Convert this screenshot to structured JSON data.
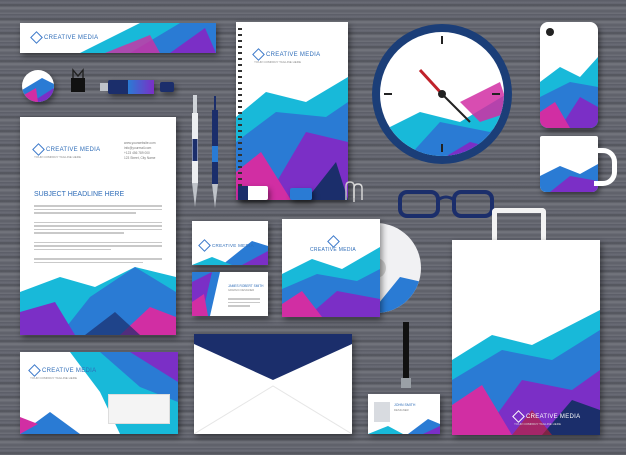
{
  "brand": {
    "name": "CREATIVE MEDIA",
    "tagline": "YOUR COMPANY TAGLINE HERE"
  },
  "letterhead": {
    "headline": "SUBJECT HEADLINE HERE",
    "contact": [
      "www.yourwebsite.com",
      "info@yourmail.com",
      "+123 456 789 000",
      "123 Street, City Name"
    ]
  },
  "business_card": {
    "person_name": "JAMES ROBERT SMITH",
    "person_title": "GRAPHIC DESIGNER"
  },
  "id_card": {
    "person_name": "JOHN SMITH",
    "person_title": "DESIGNER"
  },
  "colors": {
    "blue": "#2a7bd4",
    "purple": "#7b2fc6",
    "magenta": "#d12ea3",
    "cyan": "#18b9d9",
    "navy": "#1b2e6b"
  },
  "icons": [
    "clock-icon",
    "glasses-icon",
    "paperclip-icon",
    "usb-drive-icon",
    "pen-icon",
    "cd-disc-icon",
    "lanyard-icon"
  ]
}
